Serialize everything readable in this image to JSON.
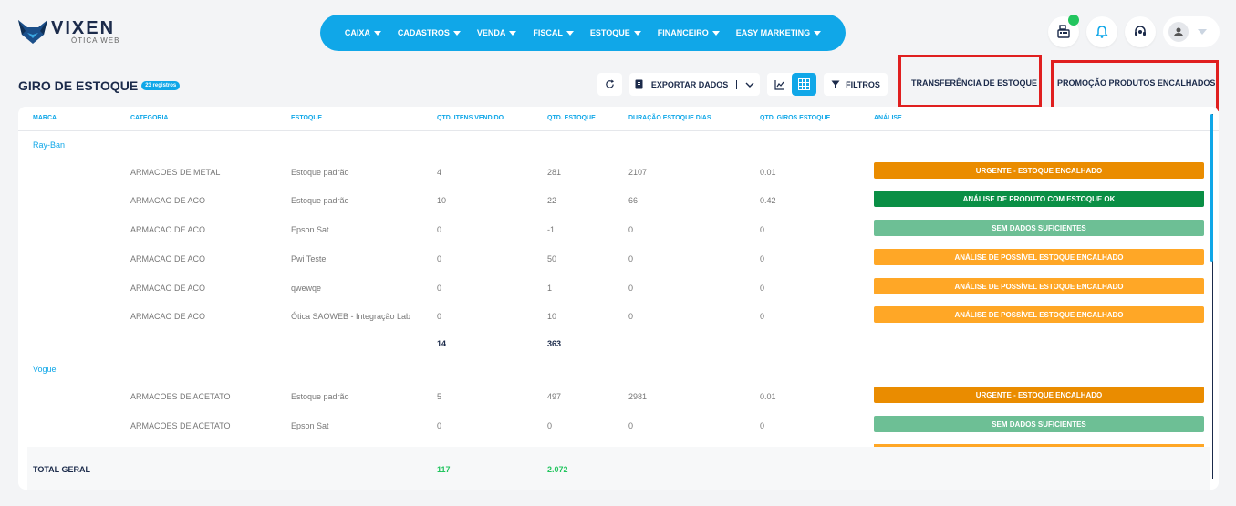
{
  "brand": {
    "name": "VIXEN",
    "subtitle": "ÓTICA WEB"
  },
  "nav": {
    "items": [
      {
        "label": "CAIXA"
      },
      {
        "label": "CADASTROS"
      },
      {
        "label": "VENDA"
      },
      {
        "label": "FISCAL"
      },
      {
        "label": "ESTOQUE"
      },
      {
        "label": "FINANCEIRO"
      },
      {
        "label": "EASY MARKETING"
      }
    ]
  },
  "header_icons": [
    "cash-register-icon",
    "bell-icon",
    "support-headset-icon",
    "user-avatar-icon"
  ],
  "colors": {
    "accent": "#10a7e8",
    "urgent": "#ea8c00",
    "ok": "#0a8f45",
    "nodata": "#6dbf95",
    "possible": "#ffa726",
    "highlight": "#e01f1f"
  },
  "page": {
    "title": "GIRO DE ESTOQUE",
    "count_badge": "23 registros"
  },
  "toolbar": {
    "export_label": "EXPORTAR DADOS",
    "filters_label": "FILTROS",
    "transfer_label": "TRANSFERÊNCIA DE ESTOQUE",
    "promo_label": "PROMOÇÃO PRODUTOS ENCALHADOS"
  },
  "table": {
    "columns": [
      "MARCA",
      "CATEGORIA",
      "ESTOQUE",
      "QTD. ITENS VENDIDO",
      "QTD. ESTOQUE",
      "DURAÇÃO ESTOQUE DIAS",
      "QTD. GIROS ESTOQUE",
      "ANÁLISE"
    ],
    "groups": [
      {
        "brand": "Ray-Ban",
        "rows": [
          {
            "categoria": "ARMACOES DE METAL",
            "estoque": "Estoque padrão",
            "vendido": "4",
            "qtd": "281",
            "duracao": "2107",
            "giros": "0.01",
            "analise": "URGENTE - ESTOQUE ENCALHADO",
            "status": "urgent"
          },
          {
            "categoria": "ARMACAO DE ACO",
            "estoque": "Estoque padrão",
            "vendido": "10",
            "qtd": "22",
            "duracao": "66",
            "giros": "0.42",
            "analise": "ANÁLISE DE PRODUTO COM ESTOQUE OK",
            "status": "ok"
          },
          {
            "categoria": "ARMACAO DE ACO",
            "estoque": "Epson Sat",
            "vendido": "0",
            "qtd": "-1",
            "duracao": "0",
            "giros": "0",
            "analise": "SEM DADOS SUFICIENTES",
            "status": "nodata"
          },
          {
            "categoria": "ARMACAO DE ACO",
            "estoque": "Pwi Teste",
            "vendido": "0",
            "qtd": "50",
            "duracao": "0",
            "giros": "0",
            "analise": "ANÁLISE DE POSSÍVEL ESTOQUE ENCALHADO",
            "status": "possible"
          },
          {
            "categoria": "ARMACAO DE ACO",
            "estoque": "qwewqe",
            "vendido": "0",
            "qtd": "1",
            "duracao": "0",
            "giros": "0",
            "analise": "ANÁLISE DE POSSÍVEL ESTOQUE ENCALHADO",
            "status": "possible"
          },
          {
            "categoria": "ARMACAO DE ACO",
            "estoque": "Ótica SAOWEB - Integração Lab",
            "vendido": "0",
            "qtd": "10",
            "duracao": "0",
            "giros": "0",
            "analise": "ANÁLISE DE POSSÍVEL ESTOQUE ENCALHADO",
            "status": "possible"
          }
        ],
        "total_vendido": "14",
        "total_qtd": "363"
      },
      {
        "brand": "Vogue",
        "rows": [
          {
            "categoria": "ARMACOES DE ACETATO",
            "estoque": "Estoque padrão",
            "vendido": "5",
            "qtd": "497",
            "duracao": "2981",
            "giros": "0.01",
            "analise": "URGENTE - ESTOQUE ENCALHADO",
            "status": "urgent"
          },
          {
            "categoria": "ARMACOES DE ACETATO",
            "estoque": "Epson Sat",
            "vendido": "0",
            "qtd": "0",
            "duracao": "0",
            "giros": "0",
            "analise": "SEM DADOS SUFICIENTES",
            "status": "nodata"
          }
        ]
      }
    ],
    "footer": {
      "label": "TOTAL GERAL",
      "vendido": "117",
      "qtd": "2.072"
    }
  }
}
